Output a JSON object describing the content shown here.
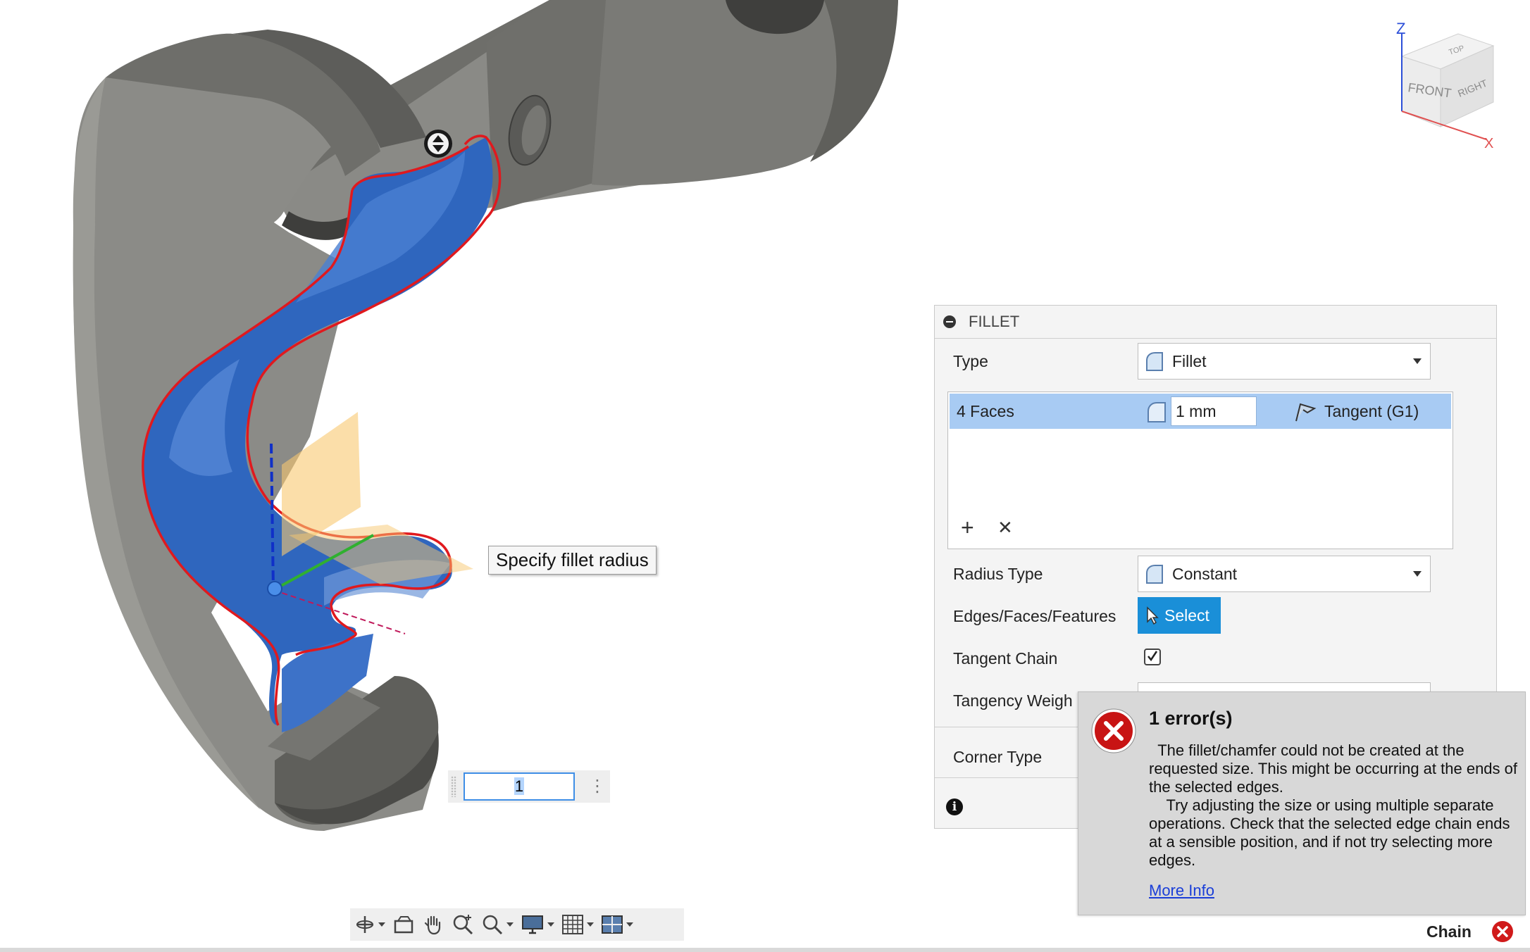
{
  "viewport": {
    "tooltip_text": "Specify fillet radius",
    "radius_input_value": "1",
    "part_color": "#858580",
    "selected_face_color": "#2f66be",
    "edge_highlight_color": "#e0191e"
  },
  "view_cube": {
    "axis_z": "Z",
    "axis_x": "X",
    "face_front": "FRONT",
    "face_right": "RIGHT",
    "face_top": "TOP"
  },
  "nav_toolbar": {
    "items": [
      "orbit-icon",
      "look-at-icon",
      "pan-icon",
      "zoom-window-icon",
      "zoom-icon",
      "display-settings-icon",
      "grid-icon",
      "viewports-icon"
    ]
  },
  "fillet_panel": {
    "title": "FILLET",
    "type_label": "Type",
    "type_value": "Fillet",
    "faces_row": {
      "name": "4 Faces",
      "radius": "1 mm",
      "continuity": "Tangent (G1)"
    },
    "add_symbol": "+",
    "remove_symbol": "✕",
    "radius_type_label": "Radius Type",
    "radius_type_value": "Constant",
    "edges_label": "Edges/Faces/Features",
    "select_button": "Select",
    "tangent_chain_label": "Tangent Chain",
    "tangent_chain_checked": true,
    "tangency_weight_label": "Tangency Weigh",
    "corner_type_label": "Corner Type",
    "accent_color": "#1a8fd8",
    "row_selected_color": "#a8cbf3"
  },
  "error": {
    "title": "1 error(s)",
    "message": "  The fillet/chamfer could not be created at the requested size. This might be occurring at the ends of the selected edges.\n    Try adjusting the size or using multiple separate operations. Check that the selected edge chain ends at a sensible position, and if not try selecting more edges.",
    "link": "More Info",
    "icon_color": "#d01a1a"
  },
  "status": {
    "chain_label": "Chain"
  }
}
